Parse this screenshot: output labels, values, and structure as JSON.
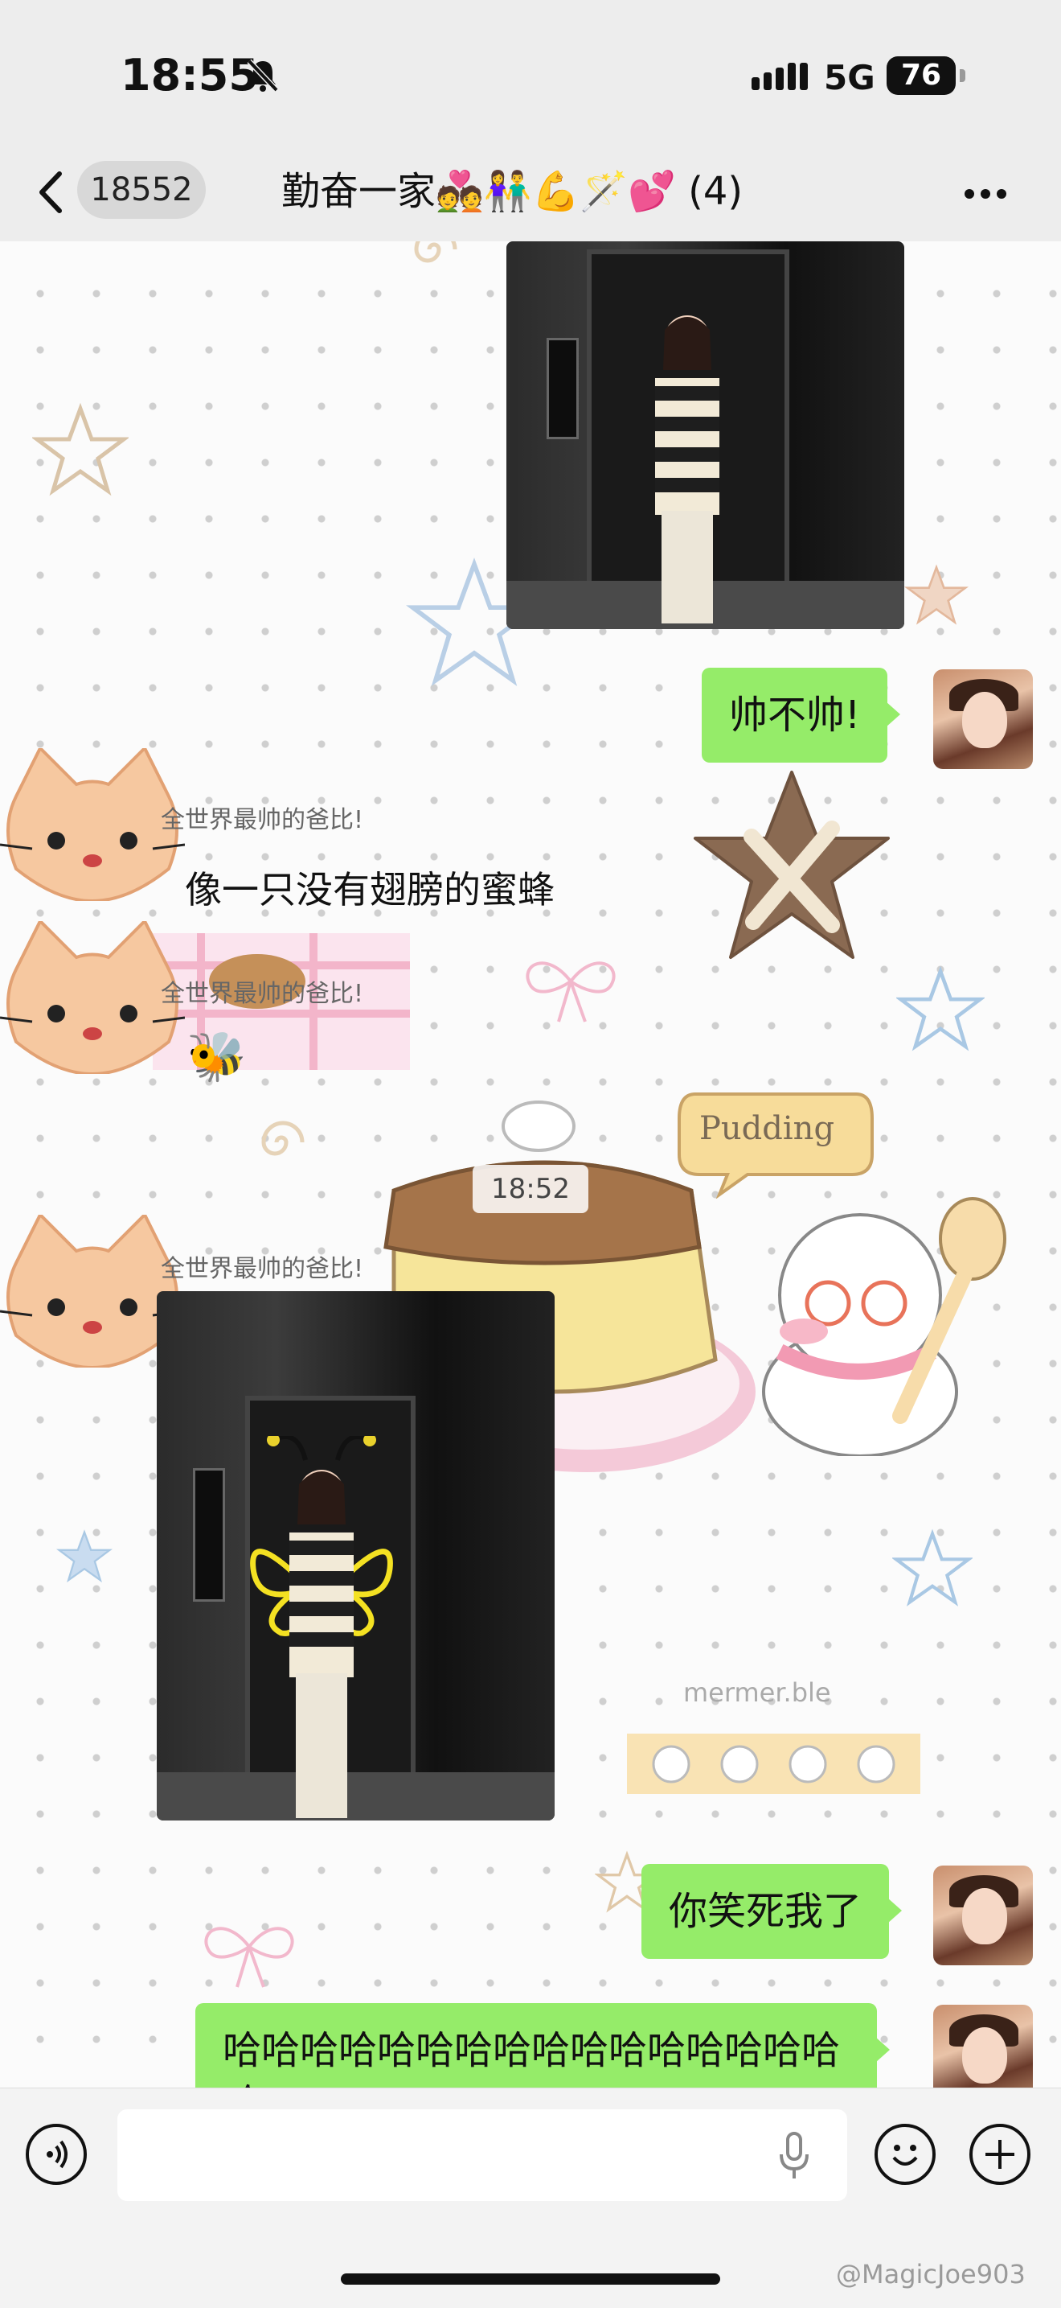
{
  "status_bar": {
    "time": "18:55",
    "network": "5G",
    "battery": "76"
  },
  "nav": {
    "unread_count": "18552",
    "title": "勤奋一家💑👫💪🪄💕 (4)"
  },
  "messages": {
    "msg1_text": "帅不帅!",
    "sender1": "全世界最帅的爸比!",
    "msg2_text": "像一只没有翅膀的蜜蜂",
    "sender2": "全世界最帅的爸比!",
    "msg3_emoji": "🐝",
    "timestamp": "18:52",
    "sender3": "全世界最帅的爸比!",
    "msg4_text": "你笑死我了",
    "msg5_text": "哈哈哈哈哈哈哈哈哈哈哈哈哈哈哈哈哈"
  },
  "wallpaper": {
    "pudding_label": "Pudding",
    "brand_label": "mermer.ble"
  },
  "input_bar": {
    "placeholder": ""
  },
  "watermark": "@MagicJoe903",
  "icons": [
    "back-chevron-icon",
    "more-dots-icon",
    "voice-mode-icon",
    "microphone-icon",
    "emoji-icon",
    "plus-icon",
    "mute-bell-icon"
  ],
  "colors": {
    "outgoing_bubble": "#95ec69",
    "bar_bg": "#ededed"
  }
}
